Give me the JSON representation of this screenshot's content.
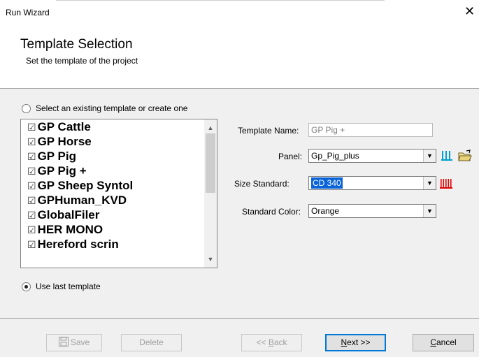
{
  "window": {
    "title": "Run Wizard",
    "close_glyph": "✕"
  },
  "header": {
    "title": "Template Selection",
    "subtitle": "Set the template of the project"
  },
  "options": {
    "select_existing_label": "Select an existing template or create one",
    "use_last_label": "Use last template",
    "selected": "use_last"
  },
  "template_list": {
    "check_glyph": "☑",
    "items": [
      "GP Cattle",
      "GP Horse",
      "GP Pig",
      "GP Pig +",
      "GP Sheep Syntol",
      "GPHuman_KVD",
      "GlobalFiler",
      "HER MONO",
      "Hereford scrin"
    ]
  },
  "form": {
    "template_name_label": "Template Name:",
    "template_name_value": "GP Pig +",
    "panel_label": "Panel:",
    "panel_value": "Gp_Pig_plus",
    "size_standard_label": "Size Standard:",
    "size_standard_value": "CD 340",
    "standard_color_label": "Standard Color:",
    "standard_color_value": "Orange"
  },
  "buttons": {
    "save": "Save",
    "delete": "Delete",
    "back_prefix": "<< ",
    "back_key": "B",
    "back_rest": "ack",
    "next_key": "N",
    "next_rest": "ext >>",
    "cancel_key": "C",
    "cancel_rest": "ancel"
  },
  "icons": {
    "panel_view": "panel-bars-icon",
    "open_folder": "open-folder-icon",
    "size_standard_view": "size-standard-bars-icon",
    "save": "floppy-disk-icon"
  },
  "colors": {
    "accent": "#0078d7",
    "selection": "#0a64d8",
    "panel_icon": "#00a0d0",
    "size_icon": "#e00000"
  }
}
